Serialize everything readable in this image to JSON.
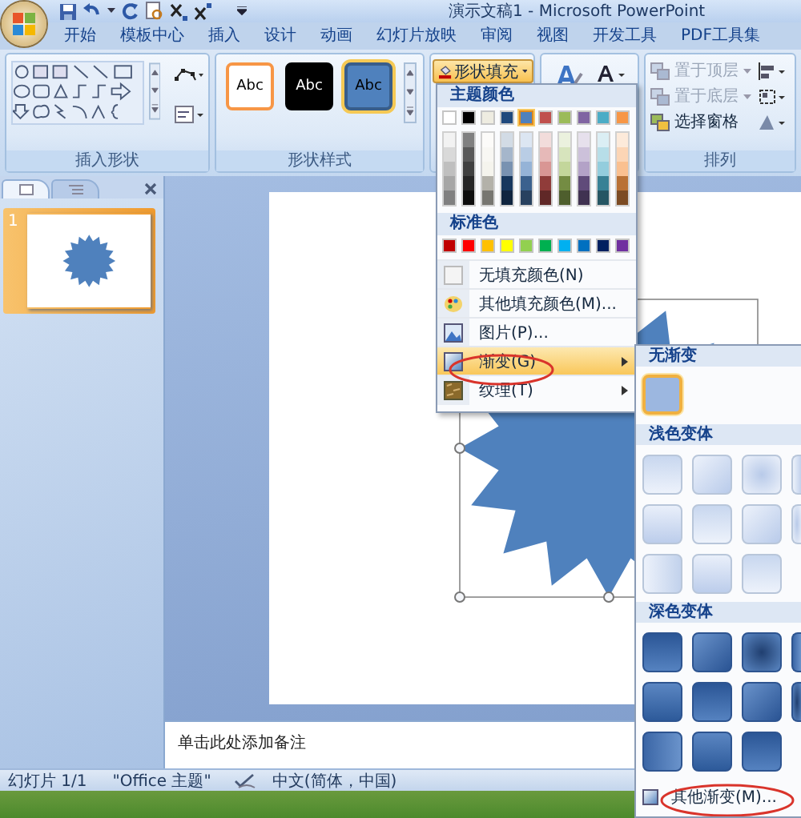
{
  "window": {
    "title": "演示文稿1 - Microsoft PowerPoint"
  },
  "tabs": [
    {
      "label": "开始",
      "selected": false
    },
    {
      "label": "模板中心",
      "selected": false
    },
    {
      "label": "插入",
      "selected": false
    },
    {
      "label": "设计",
      "selected": false
    },
    {
      "label": "动画",
      "selected": false
    },
    {
      "label": "幻灯片放映",
      "selected": false
    },
    {
      "label": "审阅",
      "selected": false
    },
    {
      "label": "视图",
      "selected": false
    },
    {
      "label": "开发工具",
      "selected": false
    },
    {
      "label": "PDF工具集",
      "selected": false
    }
  ],
  "ribbon": {
    "shapes_group": {
      "label": "插入形状"
    },
    "styles_group": {
      "label": "形状样式",
      "styles": [
        {
          "text": "Abc",
          "fill": {
            "color": "#ffffff"
          },
          "outline": {
            "color": "#f79646"
          },
          "selected": false
        },
        {
          "text": "Abc",
          "fill": {
            "color": "#000000"
          },
          "outline": {
            "color": "#000000"
          },
          "selected": false
        },
        {
          "text": "Abc",
          "fill": {
            "color": "#4f81bd"
          },
          "outline": {
            "color": "#385d8a"
          },
          "selected": true
        }
      ]
    },
    "shape_fill": {
      "label": "形状填充",
      "pressed": true
    },
    "arrange_group": {
      "label": "排列",
      "items": [
        {
          "label": "置于顶层",
          "disabled": true
        },
        {
          "label": "置于底层",
          "disabled": true
        },
        {
          "label": "选择窗格",
          "disabled": false
        }
      ]
    }
  },
  "fill_menu": {
    "theme_header": "主题颜色",
    "theme_colors": [
      {
        "color": "#ffffff",
        "selected": false
      },
      {
        "color": "#000000",
        "selected": false
      },
      {
        "color": "#eeece1",
        "selected": false
      },
      {
        "color": "#1f497d",
        "selected": false
      },
      {
        "color": "#4f81bd",
        "selected": true
      },
      {
        "color": "#c0504d",
        "selected": false
      },
      {
        "color": "#9bbb59",
        "selected": false
      },
      {
        "color": "#8064a2",
        "selected": false
      },
      {
        "color": "#4bacc6",
        "selected": false
      },
      {
        "color": "#f79646",
        "selected": false
      }
    ],
    "standard_header": "标准色",
    "standard_colors": [
      {
        "color": "#c00000"
      },
      {
        "color": "#ff0000"
      },
      {
        "color": "#ffc000"
      },
      {
        "color": "#ffff00"
      },
      {
        "color": "#92d050"
      },
      {
        "color": "#00b050"
      },
      {
        "color": "#00b0f0"
      },
      {
        "color": "#0070c0"
      },
      {
        "color": "#002060"
      },
      {
        "color": "#7030a0"
      }
    ],
    "items": [
      {
        "kind": "none",
        "label": "无填充颜色(N)",
        "submenu": false,
        "selected": false
      },
      {
        "kind": "more",
        "label": "其他填充颜色(M)...",
        "submenu": false,
        "selected": false
      },
      {
        "kind": "picture",
        "label": "图片(P)...",
        "submenu": false,
        "selected": false
      },
      {
        "kind": "gradient",
        "label": "渐变(G)",
        "submenu": true,
        "selected": true
      },
      {
        "kind": "texture",
        "label": "纹理(T)",
        "submenu": true,
        "selected": false
      }
    ]
  },
  "gradient_menu": {
    "none_header": "无渐变",
    "none_selected": true,
    "light_header": "浅色变体",
    "dark_header": "深色变体",
    "more_label": "其他渐变(M)..."
  },
  "slide_panel": {
    "slides": [
      {
        "number": "1",
        "selected": true
      }
    ]
  },
  "notes": {
    "placeholder": "单击此处添加备注"
  },
  "status_bar": {
    "slide": "幻灯片 1/1",
    "theme": "\"Office 主题\"",
    "language": "中文(简体，中国)"
  }
}
